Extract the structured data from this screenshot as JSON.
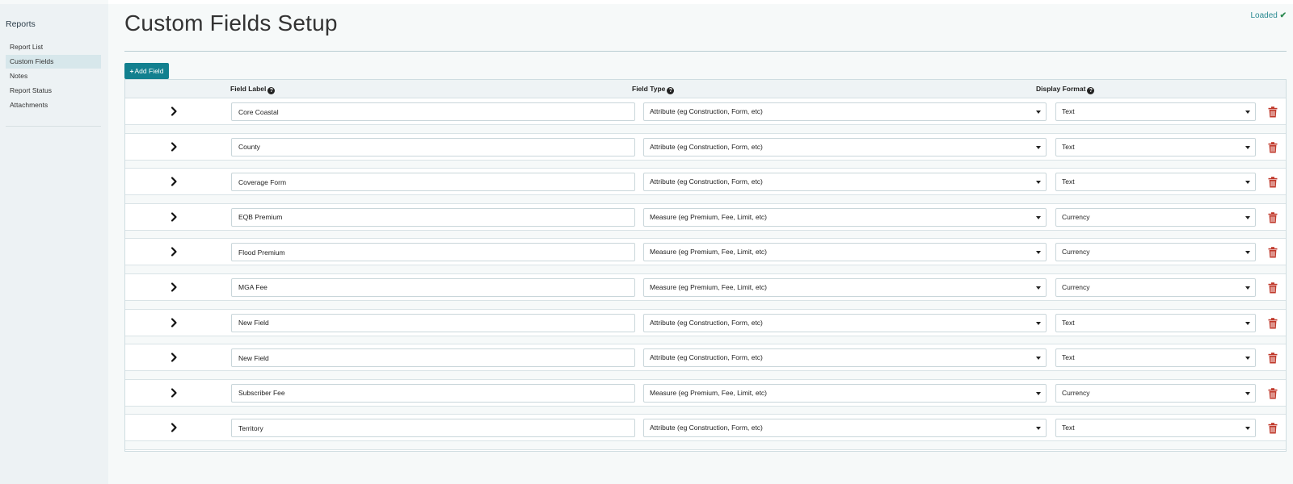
{
  "sidebar": {
    "title": "Reports",
    "items": [
      {
        "label": "Report List"
      },
      {
        "label": "Custom Fields"
      },
      {
        "label": "Notes"
      },
      {
        "label": "Report Status"
      },
      {
        "label": "Attachments"
      }
    ],
    "active": "Custom Fields"
  },
  "header": {
    "title": "Custom Fields Setup",
    "status": "Loaded"
  },
  "toolbar": {
    "add_label": "Add Field"
  },
  "table": {
    "columns": [
      "Field Label",
      "Field Type",
      "Display Format"
    ],
    "rows": [
      {
        "label": "Core Coastal",
        "type": "Attribute (eg Construction, Form, etc)",
        "format": "Text"
      },
      {
        "label": "County",
        "type": "Attribute (eg Construction, Form, etc)",
        "format": "Text"
      },
      {
        "label": "Coverage Form",
        "type": "Attribute (eg Construction, Form, etc)",
        "format": "Text"
      },
      {
        "label": "EQB Premium",
        "type": "Measure (eg Premium, Fee, Limit, etc)",
        "format": "Currency"
      },
      {
        "label": "Flood Premium",
        "type": "Measure (eg Premium, Fee, Limit, etc)",
        "format": "Currency"
      },
      {
        "label": "MGA Fee",
        "type": "Measure (eg Premium, Fee, Limit, etc)",
        "format": "Currency"
      },
      {
        "label": "New Field",
        "type": "Attribute (eg Construction, Form, etc)",
        "format": "Text"
      },
      {
        "label": "New Field",
        "type": "Attribute (eg Construction, Form, etc)",
        "format": "Text"
      },
      {
        "label": "Subscriber Fee",
        "type": "Measure (eg Premium, Fee, Limit, etc)",
        "format": "Currency"
      },
      {
        "label": "Territory",
        "type": "Attribute (eg Construction, Form, etc)",
        "format": "Text"
      }
    ]
  },
  "icons": {
    "expand": "chevron-right-icon",
    "delete": "trash-icon",
    "help": "question-circle-icon",
    "status": "check-icon",
    "add": "plus-icon"
  },
  "colors": {
    "accent": "#12808f",
    "delete": "#c0392b",
    "status_check": "#2d8a52",
    "sidebar_bg": "#edf2f4",
    "active_nav": "#d7e7eb"
  }
}
